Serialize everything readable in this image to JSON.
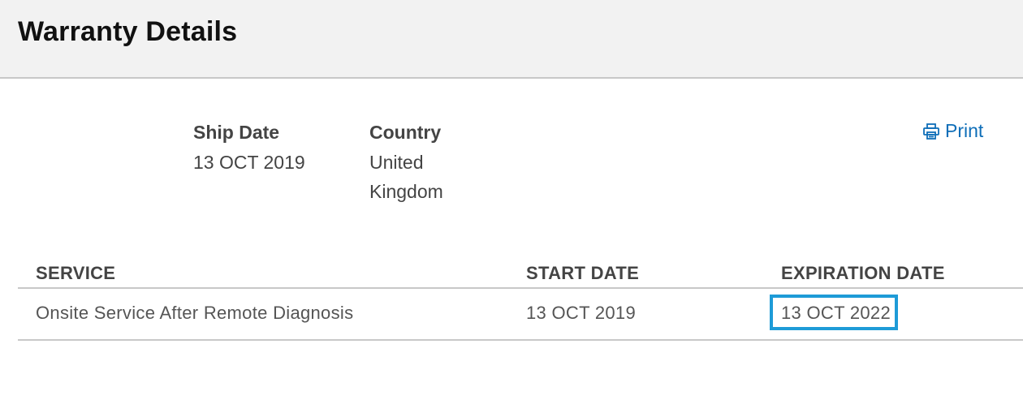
{
  "header": {
    "title": "Warranty Details"
  },
  "info": {
    "ship_date_label": "Ship Date",
    "ship_date_value": "13 OCT 2019",
    "country_label": "Country",
    "country_value_line1": "United",
    "country_value_line2": "Kingdom"
  },
  "print": {
    "label": "Print",
    "icon": "printer-icon"
  },
  "table": {
    "headers": {
      "service": "SERVICE",
      "start_date": "START DATE",
      "expiration_date": "EXPIRATION DATE"
    },
    "rows": [
      {
        "service": "Onsite Service After Remote Diagnosis",
        "start_date": "13 OCT 2019",
        "expiration_date": "13 OCT 2022"
      }
    ]
  },
  "colors": {
    "link": "#0e6eb8",
    "highlight": "#1e9bd7",
    "header_bg": "#f2f2f2"
  }
}
